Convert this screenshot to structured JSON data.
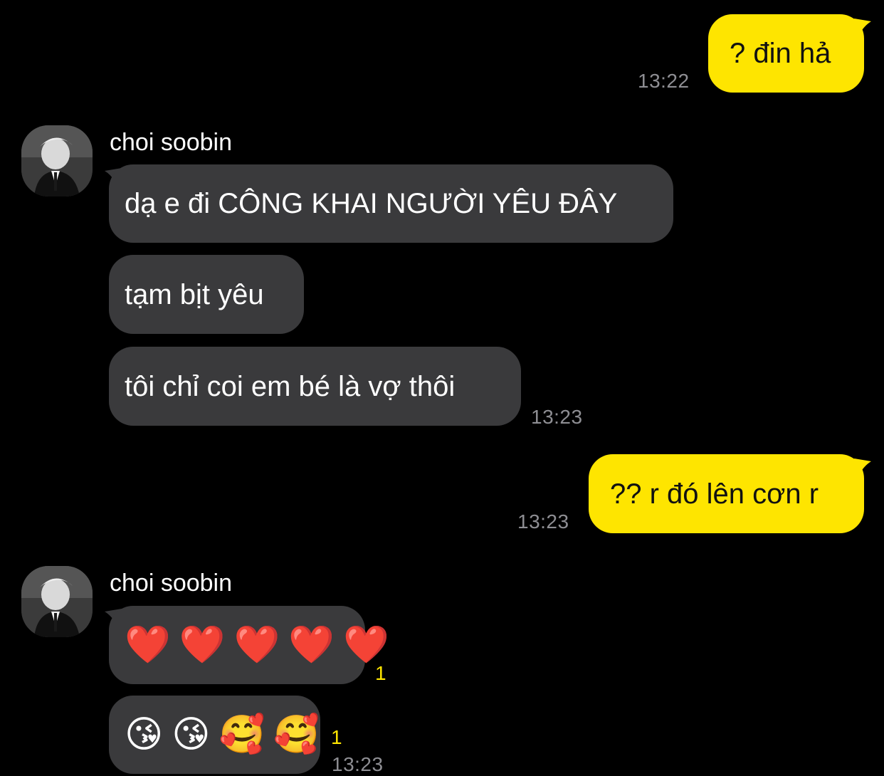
{
  "colors": {
    "background": "#000000",
    "outgoing_bubble": "#FEE500",
    "incoming_bubble": "#3A3A3C",
    "timestamp": "#8E8E93",
    "unread_count": "#FEE500"
  },
  "messages": {
    "m1": {
      "text": "? đin hả",
      "time": "13:22"
    },
    "group1": {
      "sender": "choi soobin",
      "m2": "dạ e đi CÔNG KHAI NGƯỜI YÊU ĐÂY",
      "m3": "tạm bịt yêu",
      "m4": "tôi chỉ coi em bé là vợ thôi",
      "time": "13:23"
    },
    "m5": {
      "text": "?? r đó lên cơn r",
      "time": "13:23"
    },
    "group2": {
      "sender": "choi soobin",
      "m6": {
        "emojis": [
          "❤️",
          "❤️",
          "❤️",
          "❤️",
          "❤️"
        ],
        "unread": "1"
      },
      "m7": {
        "emojis": [
          "😘",
          "😘",
          "🥰",
          "🥰"
        ],
        "unread": "1",
        "time": "13:23"
      }
    }
  }
}
